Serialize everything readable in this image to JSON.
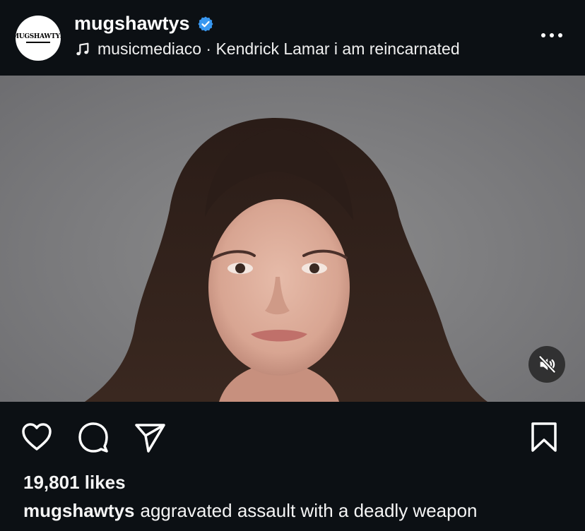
{
  "post": {
    "username": "mugshawtys",
    "avatar_text": "MUGSHAWTYS",
    "audio": {
      "artist": "musicmediaco",
      "separator": " · ",
      "track": "Kendrick Lamar i am reincarnated"
    },
    "likes": "19,801 likes",
    "caption_user": "mugshawtys",
    "caption_text": "aggravated assault with a deadly weapon"
  },
  "icons": {
    "verified": "verified-badge-icon",
    "audio": "music-note-icon",
    "more": "more-options-icon",
    "mute": "speaker-muted-icon",
    "like": "heart-icon",
    "comment": "comment-bubble-icon",
    "share": "paper-plane-icon",
    "save": "bookmark-icon"
  },
  "colors": {
    "background": "#0c1014",
    "text": "#f5f5f5",
    "verified": "#3897f0"
  }
}
